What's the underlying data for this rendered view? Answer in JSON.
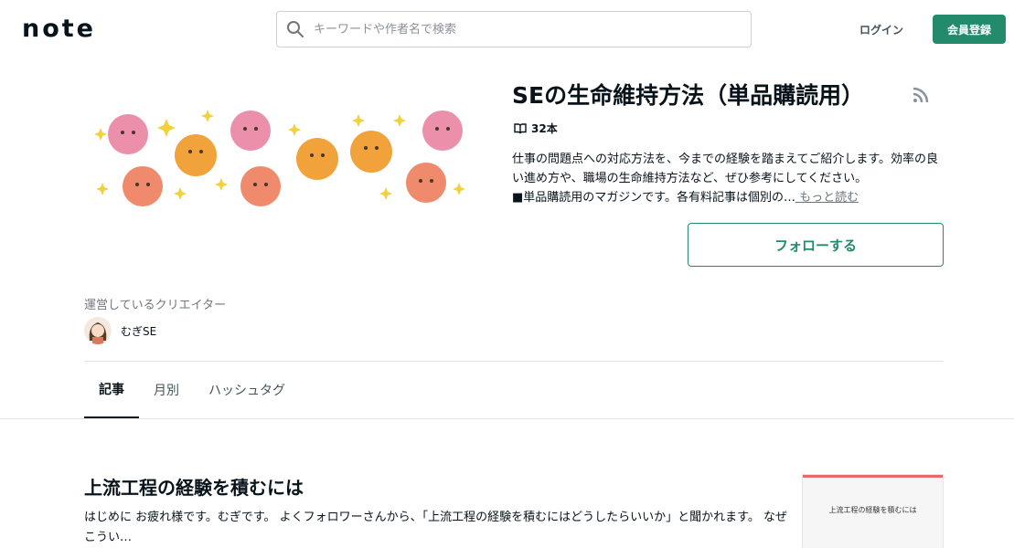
{
  "header": {
    "logo": "note",
    "search_placeholder": "キーワードや作者名で検索",
    "login_label": "ログイン",
    "signup_label": "会員登録"
  },
  "magazine": {
    "title": "SEの生命維持方法（単品購読用）",
    "count": "32本",
    "description_1": "仕事の問題点への対応方法を、今までの経験を踏まえてご紹介します。効率の良い進め方や、職場の生命維持方法など、ぜひ参考にしてください。",
    "description_2": "■単品購読用のマガジンです。各有料記事は個別の…",
    "more_label": " もっと読む",
    "follow_label": "フォローする"
  },
  "creator": {
    "label": "運営しているクリエイター",
    "name": "むぎSE"
  },
  "tabs": [
    {
      "label": "記事"
    },
    {
      "label": "月別"
    },
    {
      "label": "ハッシュタグ"
    }
  ],
  "article": {
    "title": "上流工程の経験を積むには",
    "excerpt": "はじめに お疲れ様です。むぎです。 よくフォロワーさんから、「上流工程の経験を積むにはどうしたらいいか」と聞かれます。 なぜこうい…",
    "thumb_title": "上流工程の経験を積むには"
  },
  "colors": {
    "brand": "#248a6c",
    "text": "#08131a",
    "muted": "#6e767c"
  }
}
